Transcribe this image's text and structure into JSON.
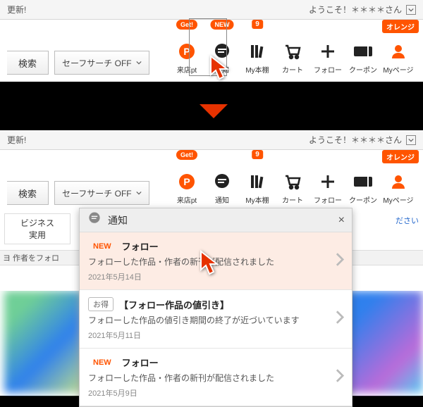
{
  "top": {
    "update": "更新!",
    "welcome": "ようこそ！＊＊＊＊さん",
    "search_btn": "検索",
    "safe_search": "セーフサーチ OFF",
    "nav": {
      "visit": {
        "label": "来店pt",
        "pill": "Get!"
      },
      "notify": {
        "label": "通知",
        "pill": "NEW"
      },
      "shelf": {
        "label": "My本棚",
        "badge": "9"
      },
      "cart": {
        "label": "カート"
      },
      "follow": {
        "label": "フォロー"
      },
      "coupon": {
        "label": "クーポン"
      },
      "mypage": {
        "label": "Myページ",
        "tag": "オレンジ"
      }
    }
  },
  "bot": {
    "update": "更新!",
    "welcome": "ようこそ！＊＊＊＊さん",
    "search_btn": "検索",
    "safe_search": "セーフサーチ OFF",
    "nav": {
      "visit": {
        "label": "来店pt",
        "pill": "Get!"
      },
      "notify": {
        "label": "通知"
      },
      "shelf": {
        "label": "My本棚",
        "badge": "9"
      },
      "cart": {
        "label": "カート"
      },
      "follow": {
        "label": "フォロー"
      },
      "coupon": {
        "label": "クーポン"
      },
      "mypage": {
        "label": "Myページ",
        "tag": "オレンジ"
      }
    },
    "sidecat1": "ビジネス",
    "sidecat2": "実用",
    "stripe": "ヨ 作者をフォロ",
    "link_mini": "ださい",
    "popover": {
      "title": "通知",
      "items": [
        {
          "tag": "NEW",
          "tagClass": "new",
          "title": "フォロー",
          "body": "フォローした作品・作者の新刊が配信されました",
          "date": "2021年5月14日"
        },
        {
          "tag": "お得",
          "tagClass": "box",
          "title": "【フォロー作品の値引き】",
          "body": "フォローした作品の値引き期間の終了が近づいています",
          "date": "2021年5月11日"
        },
        {
          "tag": "NEW",
          "tagClass": "new",
          "title": "フォロー",
          "body": "フォローした作品・作者の新刊が配信されました",
          "date": "2021年5月9日"
        }
      ]
    }
  }
}
